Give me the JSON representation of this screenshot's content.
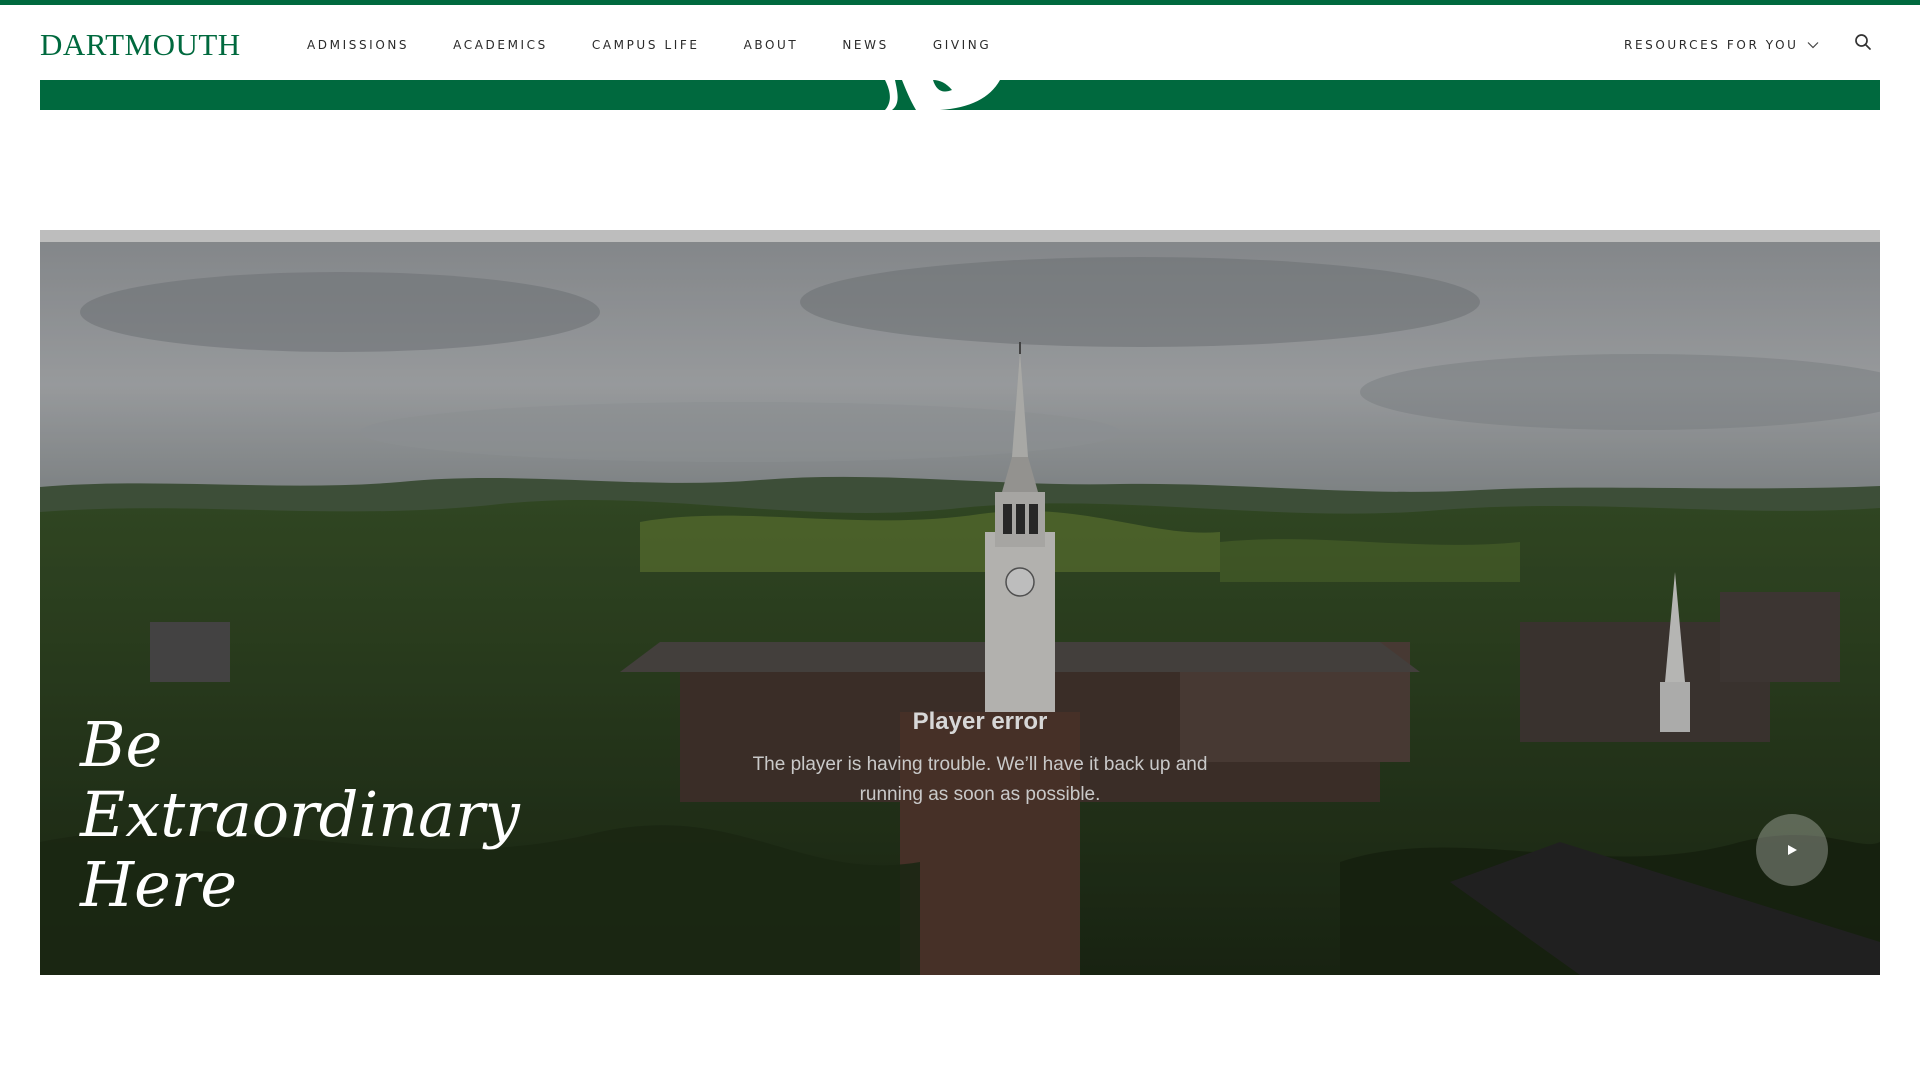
{
  "brand": {
    "logo_text": "DARTMOUTH",
    "color": "#00693e"
  },
  "nav": {
    "items": [
      {
        "label": "ADMISSIONS"
      },
      {
        "label": "ACADEMICS"
      },
      {
        "label": "CAMPUS LIFE"
      },
      {
        "label": "ABOUT"
      },
      {
        "label": "NEWS"
      },
      {
        "label": "GIVING"
      }
    ],
    "resources_label": "RESOURCES FOR YOU",
    "icons": {
      "resources": "chevron-down-icon",
      "search": "search-icon"
    }
  },
  "hero": {
    "headline": "Be Extraordinary Here",
    "player_error": {
      "title": "Player error",
      "message": "The player is having trouble. We’ll have it back up and running as soon as possible."
    },
    "play_icon": "play-icon"
  }
}
